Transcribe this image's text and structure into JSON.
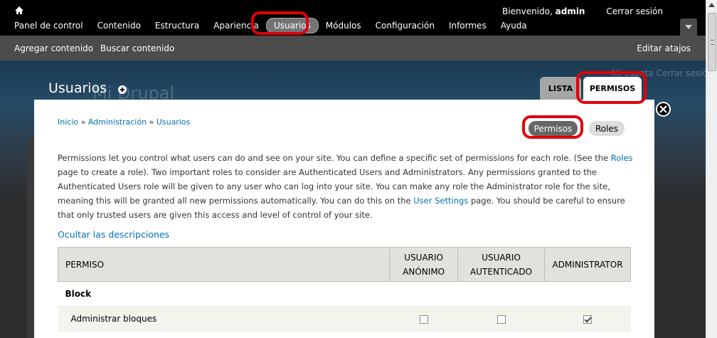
{
  "toolbar": {
    "greeting_prefix": "Bienvenido,",
    "username": "admin",
    "logout": "Cerrar sesión",
    "menu": [
      {
        "label": "Panel de control"
      },
      {
        "label": "Contenido"
      },
      {
        "label": "Estructura"
      },
      {
        "label": "Apariencia"
      },
      {
        "label": "Usuarios"
      },
      {
        "label": "Módulos"
      },
      {
        "label": "Configuración"
      },
      {
        "label": "Informes"
      },
      {
        "label": "Ayuda"
      }
    ],
    "active_item": "Usuarios"
  },
  "shortcuts": {
    "add_content": "Agregar contenido",
    "find_content": "Buscar contenido",
    "edit_shortcuts": "Editar atajos"
  },
  "background": {
    "site_name": "Mi Drupal",
    "logout_ghost": "Mi cuenta   Cerrar sesión"
  },
  "overlay": {
    "title": "Usuarios",
    "tabs": {
      "list": "LISTA",
      "permissions": "PERMISOS"
    }
  },
  "breadcrumb": {
    "home": "Inicio",
    "admin": "Administración",
    "users": "Usuarios",
    "separator": "»"
  },
  "secondary_tabs": {
    "permissions": "Permisos",
    "roles": "Roles"
  },
  "description": {
    "part1": "Permissions let you control what users can do and see on your site. You can define a specific set of permissions for each role. (See the ",
    "roles_link": "Roles",
    "part2": " page to create a role). Two important roles to consider are Authenticated Users and Administrators. Any permissions granted to the Authenticated Users role will be given to any user who can log into your site. You can make any role the Administrator role for the site, meaning this will be granted all new permissions automatically. You can do this on the ",
    "settings_link": "User Settings",
    "part3": " page. You should be careful to ensure that only trusted users are given this access and level of control of your site."
  },
  "hide_descriptions": "Ocultar las descripciones",
  "table": {
    "headers": {
      "permission": "PERMISO",
      "anonymous_line1": "USUARIO",
      "anonymous_line2": "ANÓNIMO",
      "authenticated_line1": "USUARIO",
      "authenticated_line2": "AUTENTICADO",
      "administrator": "ADMINISTRATOR"
    },
    "module": "Block",
    "rows": [
      {
        "label": "Administrar bloques",
        "anonymous": false,
        "authenticated": false,
        "administrator": true
      }
    ]
  }
}
